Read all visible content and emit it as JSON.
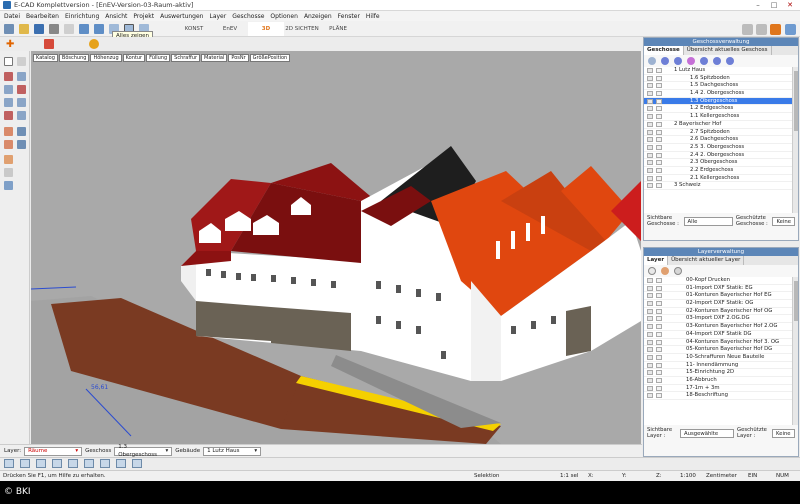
{
  "window": {
    "title": "E-CAD Komplettversion - [EnEV-Version-03-Raum-aktiv]"
  },
  "menu": [
    "Datei",
    "Bearbeiten",
    "Einrichtung",
    "Ansicht",
    "Projekt",
    "Auswertungen",
    "Layer",
    "Geschosse",
    "Optionen",
    "Anzeigen",
    "Fenster",
    "Hilfe"
  ],
  "tooltip": "Alles zeigen",
  "view_tabs": [
    {
      "label": "KONST",
      "active": false
    },
    {
      "label": "EnEV",
      "active": false
    },
    {
      "label": "3D",
      "active": true
    },
    {
      "label": "2D SICHTEN",
      "active": false
    },
    {
      "label": "PLÄNE",
      "active": false
    }
  ],
  "viewport_header": [
    "Katalog",
    "Böschung",
    "Höhenzug",
    "Kontur",
    "Füllung",
    "Schraffur",
    "Material",
    "PosNr",
    "GrößePosition"
  ],
  "dimension_label": "56,61",
  "geschoss_panel": {
    "title": "Geschossverwaltung",
    "tabs": [
      "Geschosse",
      "Übersicht aktuelles Geschoss"
    ],
    "rows": [
      {
        "label": "1 Lutz Haus",
        "level": 0,
        "group": true,
        "selected": false
      },
      {
        "label": "1.6 Spitzboden",
        "level": 1,
        "selected": false
      },
      {
        "label": "1.5 Dachgeschoss",
        "level": 1,
        "selected": false
      },
      {
        "label": "1.4 2. Obergeschoss",
        "level": 1,
        "selected": false
      },
      {
        "label": "1.3 Obergeschoss",
        "level": 1,
        "selected": true
      },
      {
        "label": "1.2 Erdgeschoss",
        "level": 1,
        "selected": false
      },
      {
        "label": "1.1 Kellergeschoss",
        "level": 1,
        "selected": false
      },
      {
        "label": "2 Bayerischer Hof",
        "level": 0,
        "group": true,
        "selected": false
      },
      {
        "label": "2.7 Spitzboden",
        "level": 1,
        "selected": false
      },
      {
        "label": "2.6 Dachgeschoss",
        "level": 1,
        "selected": false
      },
      {
        "label": "2.5 3. Obergeschoss",
        "level": 1,
        "selected": false
      },
      {
        "label": "2.4 2. Obergeschoss",
        "level": 1,
        "selected": false
      },
      {
        "label": "2.3 Obergeschoss",
        "level": 1,
        "selected": false
      },
      {
        "label": "2.2 Erdgeschoss",
        "level": 1,
        "selected": false
      },
      {
        "label": "2.1 Kellergeschoss",
        "level": 1,
        "selected": false
      },
      {
        "label": "3 Schweiz",
        "level": 0,
        "group": true,
        "selected": false
      }
    ],
    "foot": {
      "label1": "Sichtbare Geschosse :",
      "value": "Alle",
      "label2": "Geschützte Geschosse :",
      "value2": "Keine"
    }
  },
  "layer_panel": {
    "title": "Layerverwaltung",
    "tabs": [
      "Layer",
      "Übersicht aktueller Layer"
    ],
    "rows": [
      "00-Kopf Drucken",
      "01-Import DXF Statik: EG",
      "01-Konturen Bayerischer Hof EG",
      "02-Import DXF Statik: OG",
      "02-Konturen Bayerischer Hof OG",
      "03-Import DXF 2.OG.DG",
      "03-Konturen Bayerischer Hof 2.OG",
      "04-Import DXF Statik DG",
      "04-Konturen Bayerischer Hof 3. OG",
      "05-Konturen Bayerischer Hof DG",
      "10-Schraffuren Neue Bauteile",
      "11- Innendämmung",
      "15-Einrichtung 2D",
      "16-Abbruch",
      "17-1m + 3m",
      "18-Beschriftung"
    ],
    "foot": {
      "label1": "Sichtbare Layer :",
      "value": "Ausgewählte",
      "label2": "Geschützte Layer :",
      "value2": "Keine"
    }
  },
  "bottom": {
    "layer_label": "Layer:",
    "layer_value": "Räume",
    "geschoss_label": "Geschoss",
    "geschoss_value": "1.3 Obergeschoss",
    "gebaeude_label": "Gebäude",
    "gebaeude_value": "1 Lutz Haus"
  },
  "status": {
    "help": "Drücken Sie F1, um Hilfe zu erhalten.",
    "mode": "Selektion",
    "scale": "1:1 sel",
    "x": "X:",
    "y": "Y:",
    "z": "Z:",
    "zoom": "1:100",
    "unit": "Zentimeter",
    "ein": "EIN",
    "num": "NUM"
  },
  "copyright": "© BKI",
  "colors": {
    "accent": "#e0761c",
    "panel_title": "#5c86b8",
    "selection": "#3a7be8",
    "viewport_bg": "#a9a9a9"
  }
}
